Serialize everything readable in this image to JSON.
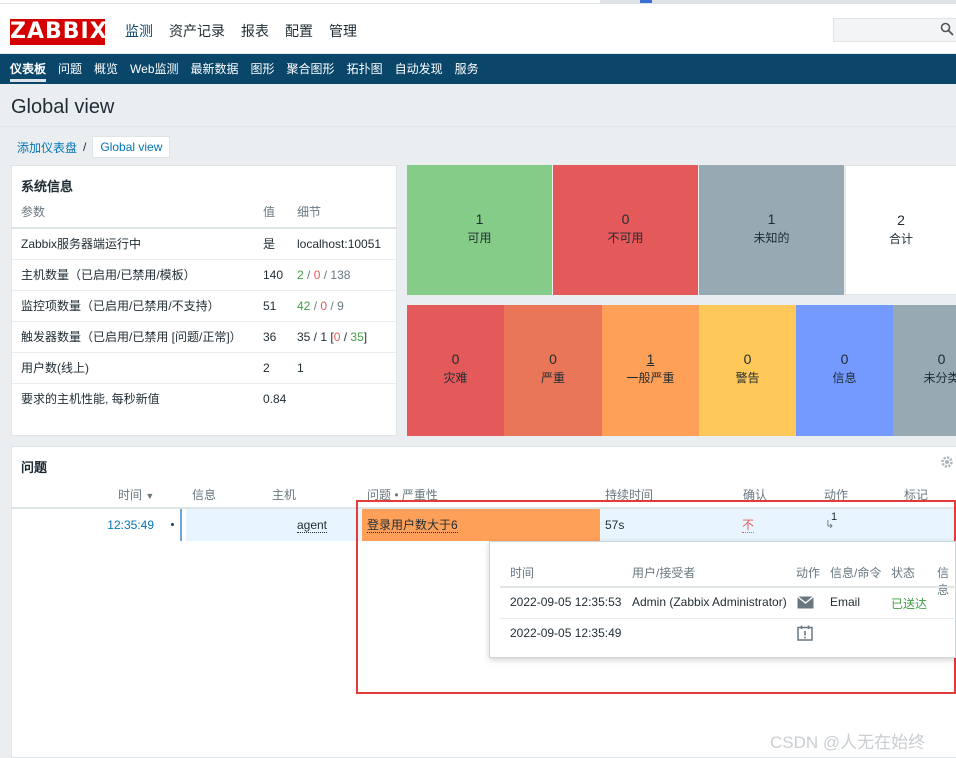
{
  "brand": {
    "logo_text": "ZABBIX",
    "logo_color": "#d40000"
  },
  "main_menu": [
    {
      "label": "监测",
      "active": true
    },
    {
      "label": "资产记录",
      "active": false
    },
    {
      "label": "报表",
      "active": false
    },
    {
      "label": "配置",
      "active": false
    },
    {
      "label": "管理",
      "active": false
    }
  ],
  "sub_nav": [
    {
      "label": "仪表板",
      "active": true
    },
    {
      "label": "问题"
    },
    {
      "label": "概览"
    },
    {
      "label": "Web监测"
    },
    {
      "label": "最新数据"
    },
    {
      "label": "图形"
    },
    {
      "label": "聚合图形"
    },
    {
      "label": "拓扑图"
    },
    {
      "label": "自动发现"
    },
    {
      "label": "服务"
    }
  ],
  "page": {
    "title": "Global view"
  },
  "breadcrumb": {
    "parent": "添加仪表盘",
    "separator": "/",
    "current": "Global view"
  },
  "system_info": {
    "title": "系统信息",
    "columns": [
      "参数",
      "值",
      "细节"
    ],
    "rows": [
      {
        "param": "Zabbix服务器端运行中",
        "value": "是",
        "detail": "localhost:10051"
      },
      {
        "param": "主机数量（已启用/已禁用/模板）",
        "value": "140",
        "d1": "2",
        "s1": " / ",
        "d2": "0",
        "s2": " / ",
        "d3": "138"
      },
      {
        "param": "监控项数量（已启用/已禁用/不支持）",
        "value": "51",
        "d1": "42",
        "s1": " / ",
        "d2": "0",
        "s2": " / ",
        "d3": "9"
      },
      {
        "param": "触发器数量（已启用/已禁用 [问题/正常]）",
        "value": "36",
        "d_prefix": "35 / 1 [",
        "d1": "0",
        "s1": " / ",
        "d2": "35",
        "d_suffix": "]"
      },
      {
        "param": "用户数(线上)",
        "value": "2",
        "detail": "1"
      },
      {
        "param": "要求的主机性能, 每秒新值",
        "value": "0.84",
        "detail": ""
      }
    ]
  },
  "host_availability": [
    {
      "count": "1",
      "label": "可用",
      "color": "#86cc89"
    },
    {
      "count": "0",
      "label": "不可用",
      "color": "#e45959"
    },
    {
      "count": "1",
      "label": "未知的",
      "color": "#97aab3"
    },
    {
      "count": "2",
      "label": "合计",
      "color": "#ffffff"
    }
  ],
  "severities": [
    {
      "count": "0",
      "label": "灾难",
      "color": "#e45959"
    },
    {
      "count": "0",
      "label": "严重",
      "color": "#e97659"
    },
    {
      "count": "1",
      "label": "一般严重",
      "color": "#ffa059"
    },
    {
      "count": "0",
      "label": "警告",
      "color": "#ffc859"
    },
    {
      "count": "0",
      "label": "信息",
      "color": "#7499ff"
    },
    {
      "count": "0",
      "label": "未分类",
      "color": "#97aab3"
    }
  ],
  "problems": {
    "title": "问题",
    "columns": {
      "time": "时间",
      "info": "信息",
      "host": "主机",
      "problem": "问题 • 严重性",
      "duration": "持续时间",
      "ack": "确认",
      "actions": "动作",
      "tags": "标记"
    },
    "rows": [
      {
        "time": "12:35:49",
        "host": "agent",
        "problem": "登录用户数大于6",
        "duration": "57s",
        "ack": "不",
        "actions": "1"
      }
    ]
  },
  "action_popup": {
    "columns": {
      "time": "时间",
      "user": "用户/接受者",
      "action": "动作",
      "message": "信息/命令",
      "status": "状态",
      "info": "信息"
    },
    "rows": [
      {
        "time": "2022-09-05 12:35:53",
        "user": "Admin (Zabbix Administrator)",
        "action_icon": "envelope-icon",
        "message": "Email",
        "status": "已送达"
      },
      {
        "time": "2022-09-05 12:35:49",
        "user": "",
        "action_icon": "calendar-alert-icon",
        "message": "",
        "status": ""
      }
    ]
  },
  "watermark": "CSDN @人无在始终"
}
